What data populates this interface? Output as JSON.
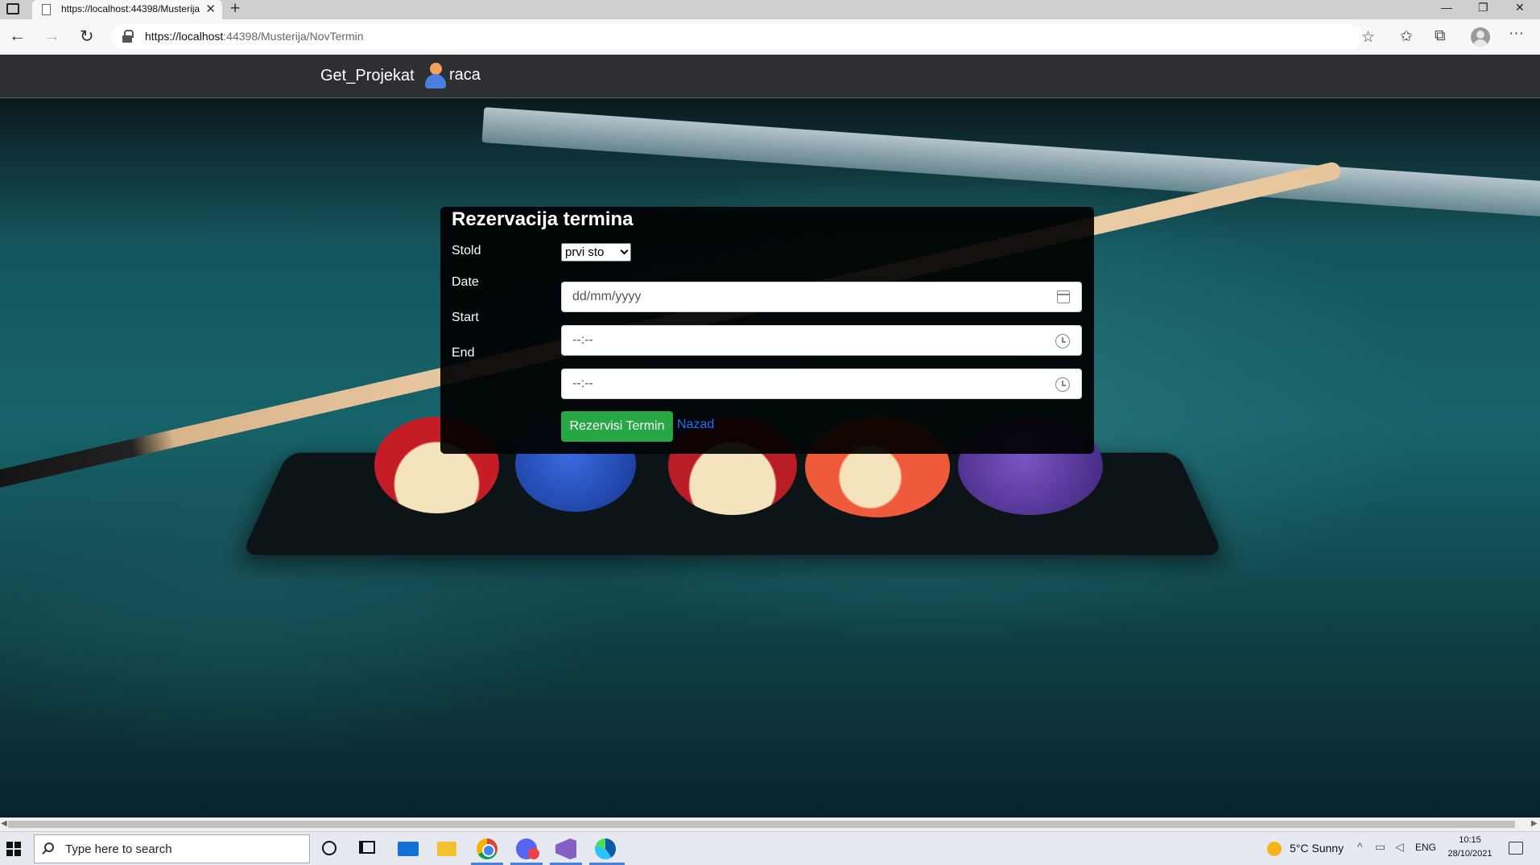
{
  "browser": {
    "tab_title": "https://localhost:44398/Musterija",
    "tab_close": "✕",
    "new_tab": "+",
    "url_host": "https://localhost",
    "url_rest": ":44398/Musterija/NovTermin",
    "back_icon": "←",
    "forward_icon": "→",
    "refresh_icon": "↻",
    "fav_add_icon": "☆",
    "favorites_icon": "✩",
    "collections_icon": "⧉",
    "more_icon": "···",
    "minimize": "—",
    "maximize": "❐",
    "close": "✕"
  },
  "navbar": {
    "brand": "Get_Projekat",
    "username": "raca"
  },
  "form": {
    "title": "Rezervacija termina",
    "stolid_label": "Stold",
    "stolid_value": "prvi sto",
    "date_label": "Date",
    "date_placeholder": "dd/mm/yyyy",
    "start_label": "Start",
    "start_placeholder": "--:--",
    "end_label": "End",
    "end_placeholder": "--:--",
    "submit_label": "Rezervisi Termin",
    "back_link": "Nazad"
  },
  "colors": {
    "navbar_bg": "#2d2f32",
    "submit_bg": "#28a745",
    "link": "#1e6fff"
  },
  "taskbar": {
    "search_placeholder": "Type here to search",
    "weather": "5°C  Sunny",
    "language": "ENG",
    "time": "10:15",
    "date": "28/10/2021",
    "chevron": "^"
  }
}
